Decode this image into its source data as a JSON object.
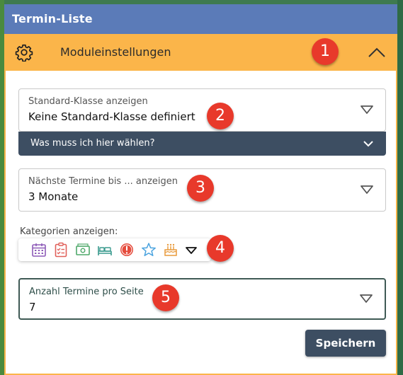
{
  "window": {
    "title": "Termin-Liste"
  },
  "settings": {
    "header_label": "Moduleinstellungen"
  },
  "fields": {
    "standard_class": {
      "label": "Standard-Klasse anzeigen",
      "value": "Keine Standard-Klasse definiert"
    },
    "help": {
      "text": "Was muss ich hier wählen?"
    },
    "next_dates": {
      "label": "Nächste Termine bis ... anzeigen",
      "value": "3 Monate"
    },
    "categories": {
      "label": "Kategorien anzeigen:",
      "icons": [
        "calendar-icon",
        "clipboard-checklist-icon",
        "money-icon",
        "bed-icon",
        "alert-icon",
        "star-icon",
        "birthday-cake-icon"
      ]
    },
    "per_page": {
      "label": "Anzahl Termine pro Seite",
      "value": "7"
    }
  },
  "buttons": {
    "save": "Speichern"
  },
  "badges": [
    "1",
    "2",
    "3",
    "4",
    "5"
  ],
  "colors": {
    "titlebar": "#5b7bb8",
    "settings_header": "#fbb54a",
    "dark_button": "#3d4e62",
    "badge": "#e8392b"
  }
}
